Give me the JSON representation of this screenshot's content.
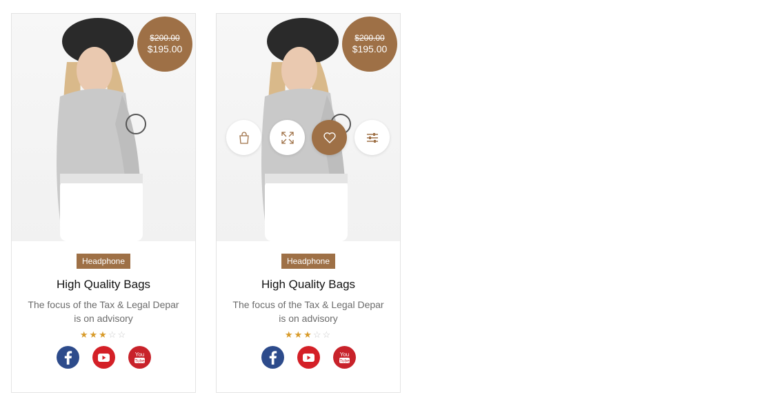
{
  "colors": {
    "accent": "#9e7046",
    "facebook": "#2d4b8b",
    "youtube": "#d42027",
    "star": "#d89b2a"
  },
  "products": [
    {
      "price_old": "$200.00",
      "price_new": "$195.00",
      "category": "Headphone",
      "title": "High Quality Bags",
      "description": "The focus of the Tax & Legal Depar is on advisory",
      "rating": 3,
      "rating_max": 5,
      "socials": [
        "facebook-icon",
        "youtube-icon",
        "youtube-logo-icon"
      ],
      "actions_visible": false
    },
    {
      "price_old": "$200.00",
      "price_new": "$195.00",
      "category": "Headphone",
      "title": "High Quality Bags",
      "description": "The focus of the Tax & Legal Depar is on advisory",
      "rating": 3,
      "rating_max": 5,
      "socials": [
        "facebook-icon",
        "youtube-icon",
        "youtube-logo-icon"
      ],
      "actions_visible": true,
      "actions": [
        "shopping-bag-icon",
        "expand-icon",
        "heart-icon",
        "sliders-icon"
      ],
      "active_action": "heart-icon"
    }
  ]
}
